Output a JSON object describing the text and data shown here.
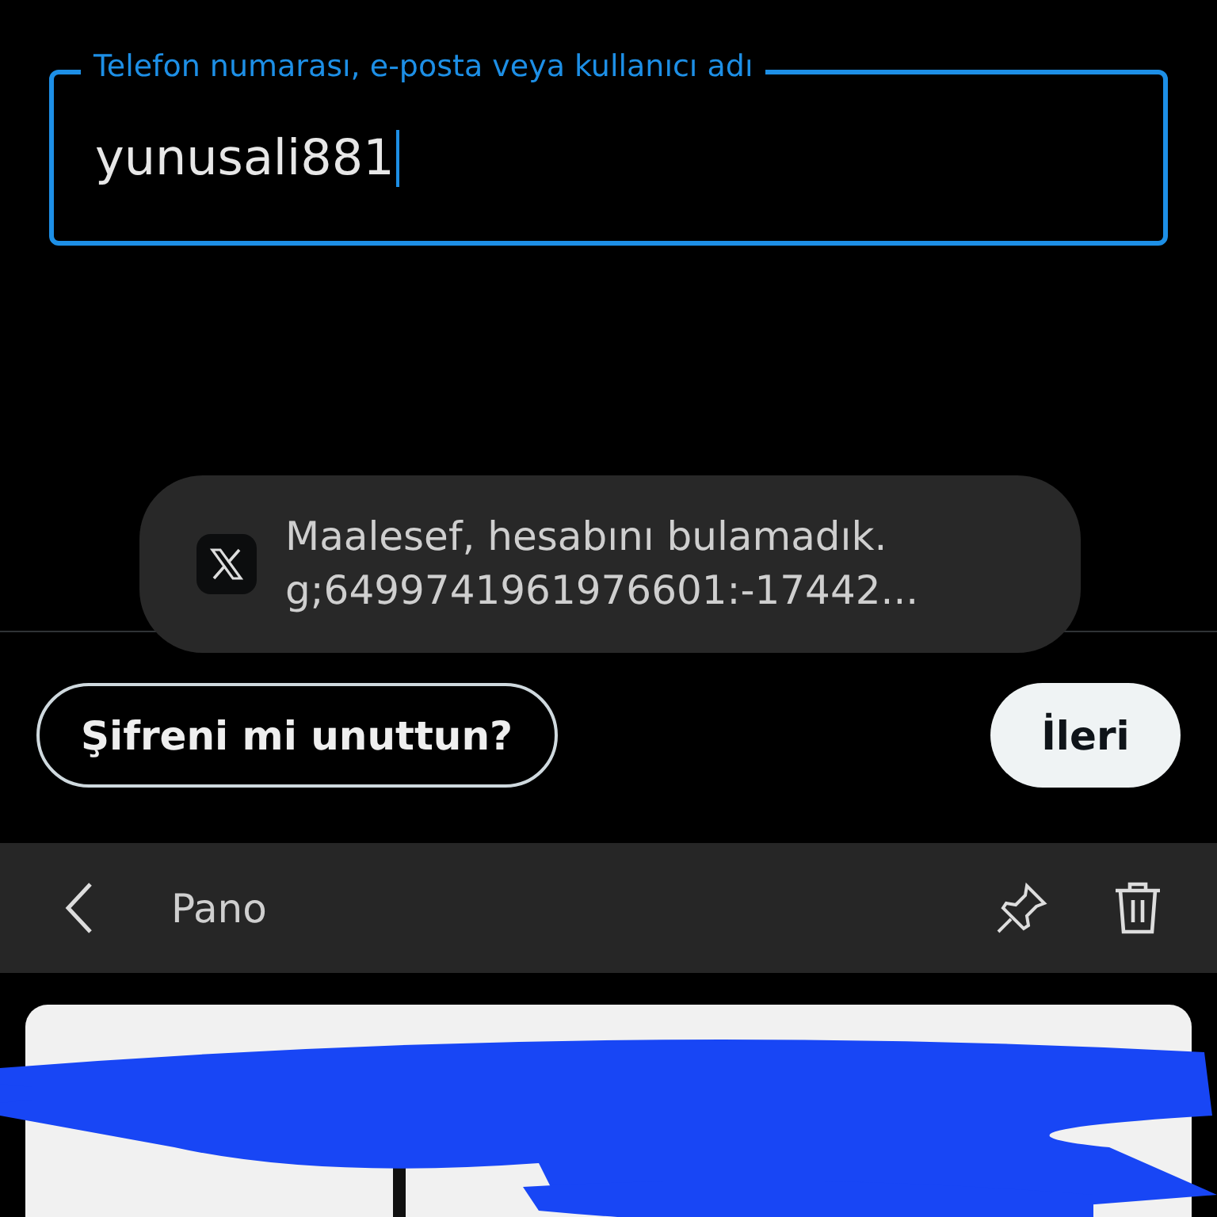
{
  "login_field": {
    "label": "Telefon numarası, e-posta veya kullanıcı adı",
    "value": "yunusali881"
  },
  "toast": {
    "lines": [
      "Maalesef, hesabını bulamadık.",
      "g;6499741961976601:-17442..."
    ]
  },
  "buttons": [
    {
      "label": "Şifreni mi unuttun?",
      "kind": "outline"
    },
    {
      "label": "İleri",
      "kind": "filled"
    }
  ],
  "clipboard": {
    "title": "Pano"
  }
}
